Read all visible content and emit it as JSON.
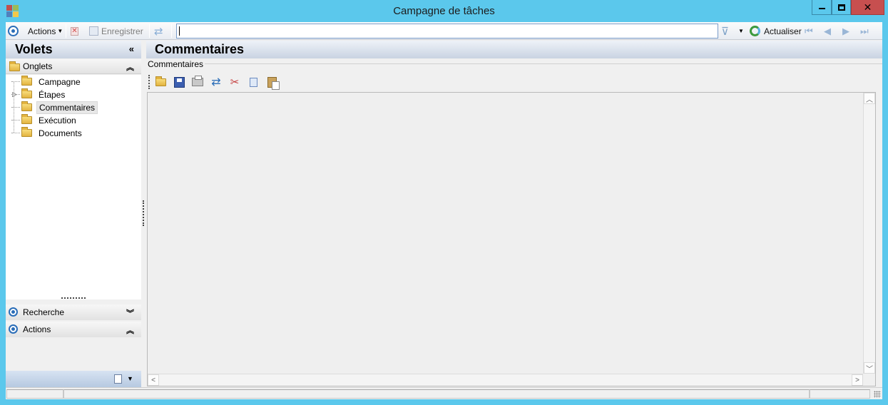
{
  "window": {
    "title": "Campagne de tâches",
    "icon_colors": [
      "#c0504d",
      "#9bbb59",
      "#4f81bd",
      "#f2c84b"
    ]
  },
  "toolbar": {
    "actions_label": "Actions",
    "save_label": "Enregistrer",
    "search_value": "",
    "refresh_label": "Actualiser"
  },
  "left_panel": {
    "title": "Volets",
    "onglets_label": "Onglets",
    "tree_items": [
      {
        "label": "Campagne",
        "expandable": false,
        "selected": false
      },
      {
        "label": "Étapes",
        "expandable": true,
        "selected": false
      },
      {
        "label": "Commentaires",
        "expandable": false,
        "selected": true
      },
      {
        "label": "Exécution",
        "expandable": false,
        "selected": false
      },
      {
        "label": "Documents",
        "expandable": false,
        "selected": false
      }
    ],
    "sections": [
      {
        "label": "Recherche",
        "state": "collapsed"
      },
      {
        "label": "Actions",
        "state": "expanded"
      }
    ]
  },
  "main": {
    "title": "Commentaires",
    "group_label": "Commentaires",
    "icons": [
      "open-folder-icon",
      "save-icon",
      "print-icon",
      "refresh-icon",
      "cut-icon",
      "copy-icon",
      "paste-icon"
    ],
    "text_content": ""
  },
  "colors": {
    "titlebar": "#5bc8ec",
    "close_button": "#c74f4f",
    "header_gradient_bottom": "#c9d3e2",
    "accent_blue": "#2a6db8"
  }
}
